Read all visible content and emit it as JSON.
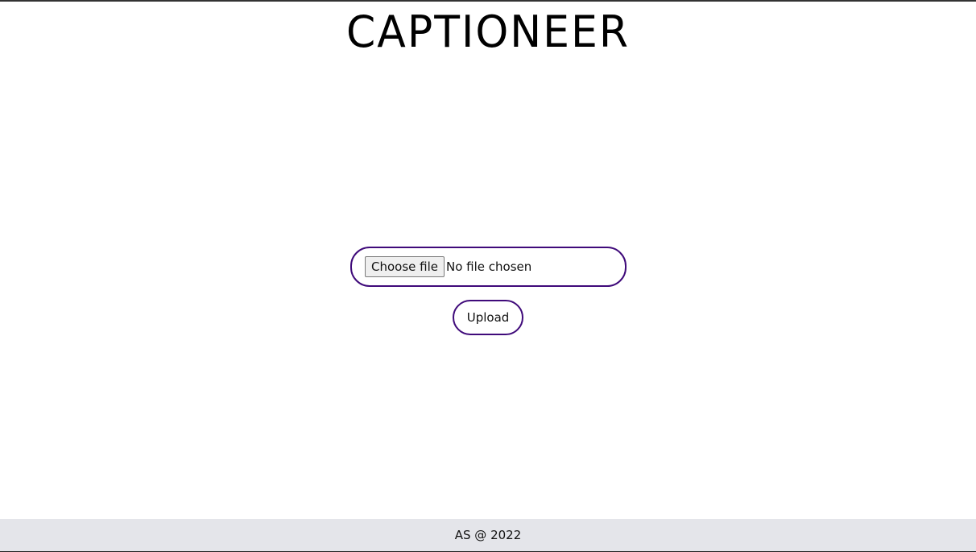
{
  "header": {
    "title": "CAPTIONEER"
  },
  "upload_form": {
    "choose_file_label": "Choose file",
    "file_status": "No file chosen",
    "upload_label": "Upload"
  },
  "footer": {
    "text": "AS @ 2022"
  },
  "colors": {
    "accent_border": "#3f0a7a",
    "footer_background": "#e4e5ea",
    "page_background": "#ffffff"
  }
}
